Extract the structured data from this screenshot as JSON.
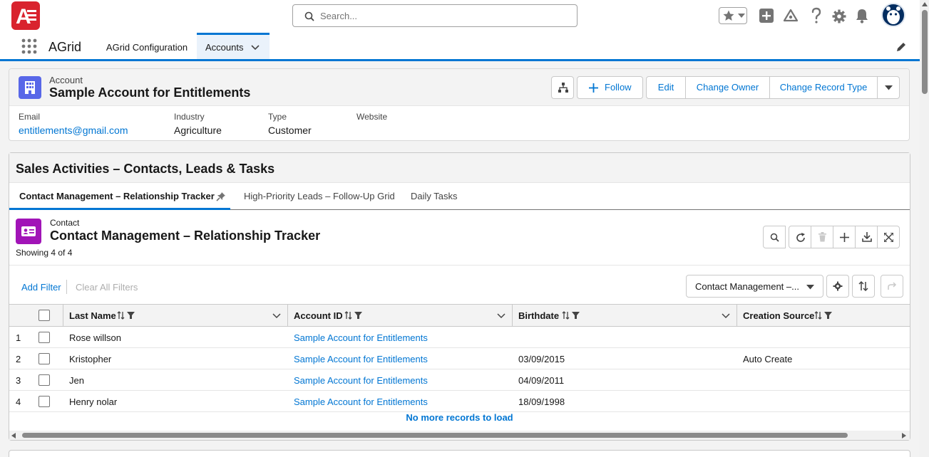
{
  "search": {
    "placeholder": "Search..."
  },
  "nav": {
    "app_name": "AGrid",
    "tabs": [
      {
        "label": "AGrid Configuration"
      },
      {
        "label": "Accounts"
      }
    ]
  },
  "account": {
    "object_type": "Account",
    "name": "Sample Account for Entitlements",
    "buttons": {
      "follow": "Follow",
      "edit": "Edit",
      "change_owner": "Change Owner",
      "change_record_type": "Change Record Type"
    },
    "fields": [
      {
        "label": "Email",
        "value": "entitlements@gmail.com"
      },
      {
        "label": "Industry",
        "value": "Agriculture"
      },
      {
        "label": "Type",
        "value": "Customer"
      },
      {
        "label": "Website",
        "value": ""
      }
    ]
  },
  "sales": {
    "title": "Sales Activities – Contacts, Leads & Tasks",
    "tabs": [
      {
        "label": "Contact Management – Relationship Tracker"
      },
      {
        "label": "High-Priority Leads – Follow-Up Grid"
      },
      {
        "label": "Daily Tasks"
      }
    ]
  },
  "grid": {
    "object_type": "Contact",
    "title": "Contact Management – Relationship Tracker",
    "showing": "Showing 4 of 4",
    "add_filter": "Add Filter",
    "clear_filters": "Clear All Filters",
    "view_select": "Contact Management –...",
    "columns": [
      "Last Name",
      "Account ID",
      "Birthdate",
      "Creation Source"
    ],
    "rows": [
      {
        "num": "1",
        "last_name": "Rose willson",
        "account": "Sample Account for Entitlements",
        "birthdate": "",
        "source": ""
      },
      {
        "num": "2",
        "last_name": "Kristopher",
        "account": "Sample Account for Entitlements",
        "birthdate": "03/09/2015",
        "source": "Auto Create"
      },
      {
        "num": "3",
        "last_name": "Jen",
        "account": "Sample Account for Entitlements",
        "birthdate": "04/09/2011",
        "source": ""
      },
      {
        "num": "4",
        "last_name": "Henry nolar",
        "account": "Sample Account for Entitlements",
        "birthdate": "18/09/1998",
        "source": ""
      }
    ],
    "no_more": "No more records to load"
  },
  "icons": [
    "app-logo",
    "search-icon",
    "favorites-star-icon",
    "add-icon",
    "trailhead-icon",
    "help-icon",
    "gear-icon",
    "bell-icon",
    "user-avatar",
    "app-launcher-icon",
    "edit-pencil-icon",
    "hierarchy-icon",
    "account-icon",
    "contact-icon",
    "pin-icon",
    "refresh-icon",
    "delete-icon",
    "download-icon",
    "expand-icon",
    "sort-icon",
    "filter-icon"
  ],
  "colors": {
    "brand": "#0176d3",
    "logo": "#d9232e",
    "account_icon": "#5867e8",
    "contact_icon": "#a114b7"
  }
}
